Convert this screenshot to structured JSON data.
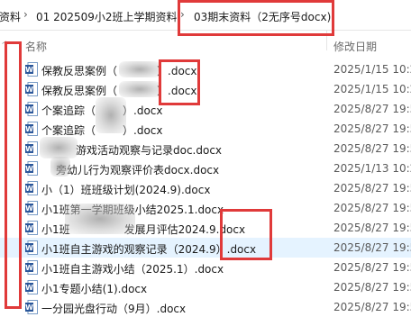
{
  "breadcrumb": {
    "items": [
      "资料",
      "01 202509小2班上学期资料",
      "03期末资料（2无序号docx)"
    ],
    "separator": "›"
  },
  "columns": {
    "name": "名称",
    "date": "修改日期"
  },
  "files": [
    {
      "name_prefix": "保教反思案例（",
      "name_suffix": "）.docx",
      "date": "2025/1/15 10:2"
    },
    {
      "name_prefix": "保教反思案例（",
      "name_suffix": "）.docx",
      "date": "2025/1/15 10:2"
    },
    {
      "name_prefix": "个案追踪（",
      "name_suffix": "）.docx",
      "date": "2025/8/27 19:5"
    },
    {
      "name_prefix": "个案追踪（",
      "name_suffix": "）.docx",
      "date": "2025/8/27 19:5"
    },
    {
      "name_prefix": "",
      "name_suffix": "游戏活动观察与记录doc.docx",
      "date": "2025/8/27 19:5"
    },
    {
      "name_prefix": "",
      "name_suffix": "旁幼儿行为观察评价表docx.docx",
      "date": "2025/1/13 10:2"
    },
    {
      "name_prefix": "小（1）班班级计划(2024.9).docx",
      "name_suffix": "",
      "date": "2025/8/27 19:5"
    },
    {
      "name_prefix": "小1班第一学期班级小结2025.1.docx",
      "name_suffix": "",
      "date": "2025/8/27 19:5"
    },
    {
      "name_prefix": "小1班",
      "name_suffix": "发展月评估2024.9.docx",
      "date": "2025/8/27 19:5"
    },
    {
      "name_prefix": "小1班自主游戏的观察记录（2024.9）.docx",
      "name_suffix": "",
      "date": "2025/8/27 19:5"
    },
    {
      "name_prefix": "小1班自主游戏小结（2025.1）.docx",
      "name_suffix": "",
      "date": "2025/8/27 19:5"
    },
    {
      "name_prefix": "小1专题小结(1).docx",
      "name_suffix": "",
      "date": "2025/8/27 19:5"
    },
    {
      "name_prefix": "一分园光盘行动（9月）.docx",
      "name_suffix": "",
      "date": "2025/8/27 19:5"
    }
  ],
  "colors": {
    "highlight": "#e03a3a",
    "word_blue": "#2b579a",
    "hover": "#e5f3ff"
  },
  "icons": {
    "file": "word-doc-icon",
    "sort": "sort-up-icon"
  }
}
